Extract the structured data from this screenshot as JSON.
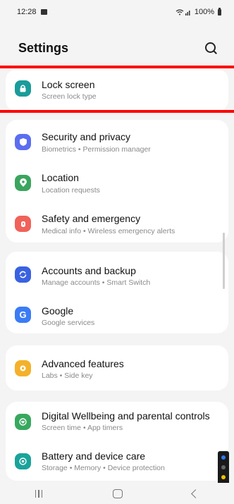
{
  "status_bar": {
    "time": "12:28",
    "battery": "100%",
    "notification_icon": "gallery-icon",
    "signal_icon": "wifi-signal-icon"
  },
  "header": {
    "title": "Settings",
    "search_icon": "search-icon"
  },
  "items": [
    {
      "key": "lock-screen",
      "title": "Lock screen",
      "subtitle": "Screen lock type",
      "icon": "lock-icon",
      "icon_color": "#1a9c9a"
    },
    {
      "key": "security-privacy",
      "title": "Security and privacy",
      "subtitle": "Biometrics  •  Permission manager",
      "icon": "shield-icon",
      "icon_color": "#5b6ef0"
    },
    {
      "key": "location",
      "title": "Location",
      "subtitle": "Location requests",
      "icon": "location-pin-icon",
      "icon_color": "#3aa55e"
    },
    {
      "key": "safety-emergency",
      "title": "Safety and emergency",
      "subtitle": "Medical info  •  Wireless emergency alerts",
      "icon": "emergency-icon",
      "icon_color": "#f0625a"
    },
    {
      "key": "accounts-backup",
      "title": "Accounts and backup",
      "subtitle": "Manage accounts  •  Smart Switch",
      "icon": "sync-icon",
      "icon_color": "#3a62e0"
    },
    {
      "key": "google",
      "title": "Google",
      "subtitle": "Google services",
      "icon": "google-icon",
      "icon_color": "#3b7cf5"
    },
    {
      "key": "advanced-features",
      "title": "Advanced features",
      "subtitle": "Labs  •  Side key",
      "icon": "gear-plus-icon",
      "icon_color": "#f4b12a"
    },
    {
      "key": "digital-wellbeing",
      "title": "Digital Wellbeing and parental controls",
      "subtitle": "Screen time  •  App timers",
      "icon": "wellbeing-icon",
      "icon_color": "#38a85f"
    },
    {
      "key": "battery-care",
      "title": "Battery and device care",
      "subtitle": "Storage  •  Memory  •  Device protection",
      "icon": "device-care-icon",
      "icon_color": "#1aa39b"
    }
  ],
  "nav": {
    "recent_icon": "recent-apps-icon",
    "home_icon": "home-icon",
    "back_icon": "back-icon"
  },
  "colors": {
    "background": "#f4f4f4",
    "card": "#ffffff",
    "highlight": "#ff0000"
  }
}
